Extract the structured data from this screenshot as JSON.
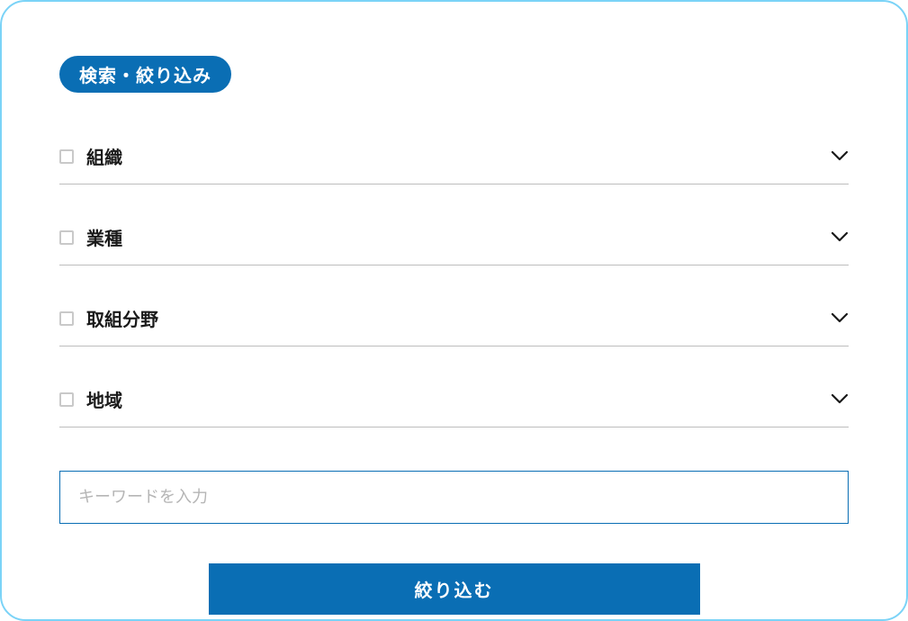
{
  "badge": "検索・絞り込み",
  "filters": [
    {
      "label": "組織"
    },
    {
      "label": "業種"
    },
    {
      "label": "取組分野"
    },
    {
      "label": "地域"
    }
  ],
  "keyword": {
    "placeholder": "キーワードを入力"
  },
  "submit_label": "絞り込む"
}
